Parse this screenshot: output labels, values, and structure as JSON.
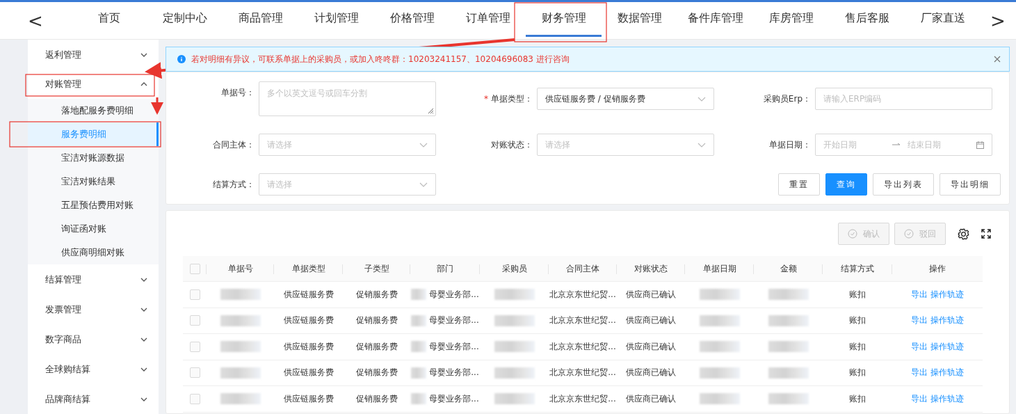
{
  "nav": {
    "back": "<",
    "forward": ">",
    "tabs": [
      {
        "label": "首页",
        "selected": false
      },
      {
        "label": "定制中心",
        "selected": false
      },
      {
        "label": "商品管理",
        "selected": false
      },
      {
        "label": "计划管理",
        "selected": false
      },
      {
        "label": "价格管理",
        "selected": false
      },
      {
        "label": "订单管理",
        "selected": false
      },
      {
        "label": "财务管理",
        "selected": true
      },
      {
        "label": "数据管理",
        "selected": false
      },
      {
        "label": "备件库管理",
        "selected": false
      },
      {
        "label": "库房管理",
        "selected": false
      },
      {
        "label": "售后客服",
        "selected": false
      },
      {
        "label": "厂家直送",
        "selected": false
      }
    ]
  },
  "sidebar": {
    "items": [
      {
        "label": "返利管理",
        "expanded": false
      },
      {
        "label": "对账管理",
        "expanded": true,
        "children": [
          {
            "label": "落地配服务费明细",
            "selected": false
          },
          {
            "label": "服务费明细",
            "selected": true
          },
          {
            "label": "宝洁对账源数据",
            "selected": false
          },
          {
            "label": "宝洁对账结果",
            "selected": false
          },
          {
            "label": "五星预估费用对账",
            "selected": false
          },
          {
            "label": "询证函对账",
            "selected": false
          },
          {
            "label": "供应商明细对账",
            "selected": false
          }
        ]
      },
      {
        "label": "结算管理",
        "expanded": false
      },
      {
        "label": "发票管理",
        "expanded": false
      },
      {
        "label": "数字商品",
        "expanded": false
      },
      {
        "label": "全球购结算",
        "expanded": false
      },
      {
        "label": "品牌商结算",
        "expanded": false
      }
    ]
  },
  "alert": {
    "text": "若对明细有异议，可联系单据上的采购员，或加入咚咚群：10203241157、10204696083 进行咨询"
  },
  "filters": [
    {
      "label": "单据号：",
      "kind": "textarea",
      "placeholder": "多个以英文逗号或回车分割"
    },
    {
      "label": "单据类型：",
      "required_mark": "*",
      "kind": "select",
      "value": "供应链服务费 / 促销服务费"
    },
    {
      "label": "采购员Erp：",
      "kind": "input",
      "placeholder": "请输入ERP编码"
    },
    {
      "label": "合同主体：",
      "kind": "select",
      "placeholder": "请选择"
    },
    {
      "label": "对账状态：",
      "kind": "select",
      "placeholder": "请选择"
    },
    {
      "label": "单据日期：",
      "kind": "daterange",
      "placeholder": "开始日期",
      "placeholder_end": "结束日期"
    },
    {
      "label": "结算方式：",
      "kind": "select",
      "placeholder": "请选择"
    }
  ],
  "filter_buttons": [
    {
      "label": "重置",
      "primary": false
    },
    {
      "label": "查询",
      "primary": true
    },
    {
      "label": "导出列表",
      "primary": false
    },
    {
      "label": "导出明细",
      "primary": false
    }
  ],
  "toolbar": [
    {
      "label": "确认",
      "disabled": true
    },
    {
      "label": "驳回",
      "disabled": true
    }
  ],
  "table": {
    "header_checked": false,
    "columns": [
      {
        "label": "单据号",
        "kind": "redacted"
      },
      {
        "label": "单据类型",
        "kind": "text"
      },
      {
        "label": "子类型",
        "kind": "text"
      },
      {
        "label": "部门",
        "kind": "partial"
      },
      {
        "label": "采购员",
        "kind": "redacted"
      },
      {
        "label": "合同主体",
        "kind": "text"
      },
      {
        "label": "对账状态",
        "kind": "text"
      },
      {
        "label": "单据日期",
        "kind": "redacted"
      },
      {
        "label": "金额",
        "kind": "redacted"
      },
      {
        "label": "结算方式",
        "kind": "text"
      },
      {
        "label": "操作",
        "kind": "links"
      }
    ],
    "rows": [
      {
        "checked": false,
        "cells": [
          "",
          "供应链服务费",
          "促销服务费",
          "母婴业务部...",
          "",
          "北京京东世纪贸...",
          "供应商已确认",
          "",
          "",
          "账扣",
          [
            "导出",
            "操作轨迹"
          ]
        ]
      },
      {
        "checked": false,
        "cells": [
          "",
          "供应链服务费",
          "促销服务费",
          "母婴业务部...",
          "",
          "北京京东世纪贸...",
          "供应商已确认",
          "",
          "",
          "账扣",
          [
            "导出",
            "操作轨迹"
          ]
        ]
      },
      {
        "checked": false,
        "cells": [
          "",
          "供应链服务费",
          "促销服务费",
          "母婴业务部...",
          "",
          "北京京东世纪贸...",
          "供应商已确认",
          "",
          "",
          "账扣",
          [
            "导出",
            "操作轨迹"
          ]
        ]
      },
      {
        "checked": false,
        "cells": [
          "",
          "供应链服务费",
          "促销服务费",
          "母婴业务部...",
          "",
          "北京京东世纪贸...",
          "供应商已确认",
          "",
          "",
          "账扣",
          [
            "导出",
            "操作轨迹"
          ]
        ]
      },
      {
        "checked": false,
        "cells": [
          "",
          "供应链服务费",
          "促销服务费",
          "母婴业务部...",
          "",
          "北京京东世纪贸...",
          "供应商已确认",
          "",
          "",
          "账扣",
          [
            "导出",
            "操作轨迹"
          ]
        ]
      }
    ]
  }
}
